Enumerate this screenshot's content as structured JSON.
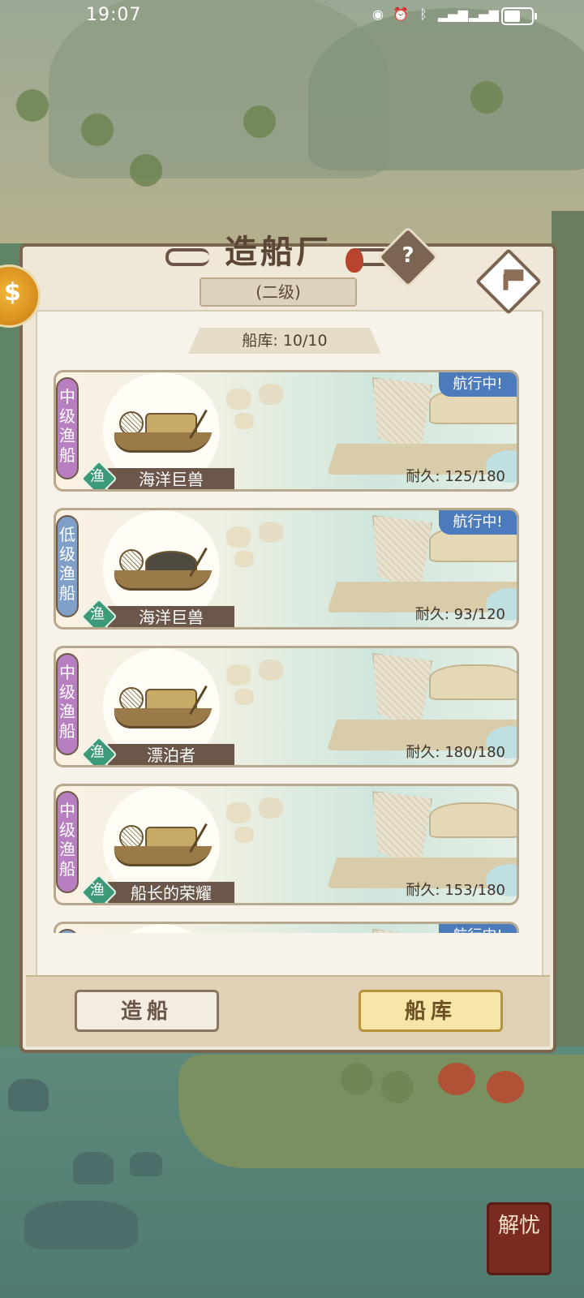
{
  "status_bar": {
    "time": "19:07",
    "icons": [
      "eye-icon",
      "alarm-icon",
      "bluetooth-icon",
      "5g-signal-icon",
      "4g-signal-icon",
      "battery-icon"
    ],
    "battery_level": 0.6
  },
  "panel": {
    "title": "造船厂",
    "level": "(二级)",
    "capacity": "船库: 10/10"
  },
  "ships": [
    {
      "tier": "中级渔船",
      "tier_type": "mid",
      "type_badge": "渔",
      "name": "海洋巨兽",
      "status": "航行中!",
      "durability": "耐久: 125/180",
      "roof": "straw"
    },
    {
      "tier": "低级渔船",
      "tier_type": "low",
      "type_badge": "渔",
      "name": "海洋巨兽",
      "status": "航行中!",
      "durability": "耐久: 93/120",
      "roof": "dark"
    },
    {
      "tier": "中级渔船",
      "tier_type": "mid",
      "type_badge": "渔",
      "name": "漂泊者",
      "status": "",
      "durability": "耐久: 180/180",
      "roof": "straw"
    },
    {
      "tier": "中级渔船",
      "tier_type": "mid",
      "type_badge": "渔",
      "name": "船长的荣耀",
      "status": "",
      "durability": "耐久: 153/180",
      "roof": "straw"
    },
    {
      "tier": "",
      "tier_type": "low",
      "type_badge": "",
      "name": "",
      "status": "航行中!",
      "durability": "",
      "roof": "straw"
    }
  ],
  "buttons": {
    "build": "造船",
    "dock": "船库"
  },
  "corner_button": "解忧",
  "colors": {
    "mid_tier": "#b77fbf",
    "low_tier": "#7f9fc8",
    "status_sailing": "#4b7bbd",
    "fish_badge": "#3d9a78"
  }
}
